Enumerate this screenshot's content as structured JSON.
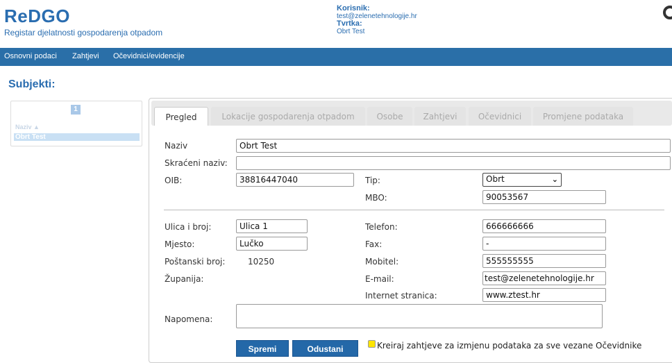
{
  "header": {
    "logo": "ReDGO",
    "tagline": "Registar djelatnosti gospodarenja otpadom",
    "user_label": "Korisnik:",
    "user_value": "test@zelenetehnologije.hr",
    "company_label": "Tvrtka:",
    "company_value": "Obrt Test"
  },
  "nav": {
    "items": [
      "Osnovni podaci",
      "Zahtjevi",
      "Očevidnici/evidencije"
    ]
  },
  "section_title": "Subjekti:",
  "left_list": {
    "page": "1",
    "column_header": "Naziv ▲",
    "selected_row": "Obrt Test"
  },
  "tabs": [
    "Pregled",
    "Lokacije gospodarenja otpadom",
    "Osobe",
    "Zahtjevi",
    "Očevidnici",
    "Promjene podataka"
  ],
  "form": {
    "naziv_label": "Naziv",
    "naziv_value": "Obrt Test",
    "skraceni_label": "Skraćeni naziv:",
    "skraceni_value": "",
    "oib_label": "OIB:",
    "oib_value": "38816447040",
    "tip_label": "Tip:",
    "tip_value": "Obrt",
    "mbo_label": "MBO:",
    "mbo_value": "90053567",
    "ulica_label": "Ulica i broj:",
    "ulica_value": "Ulica 1",
    "telefon_label": "Telefon:",
    "telefon_value": "666666666",
    "mjesto_label": "Mjesto:",
    "mjesto_value": "Lučko",
    "fax_label": "Fax:",
    "fax_value": "-",
    "postanski_label": "Poštanski broj:",
    "postanski_value": "10250",
    "mobitel_label": "Mobitel:",
    "mobitel_value": "555555555",
    "zupanija_label": "Županija:",
    "email_label": "E-mail:",
    "email_value": "test@zelenetehnologije.hr",
    "web_label": "Internet stranica:",
    "web_value": "www.ztest.hr",
    "napomena_label": "Napomena:",
    "napomena_value": ""
  },
  "actions": {
    "save": "Spremi",
    "cancel": "Odustani",
    "checkbox_label": "Kreiraj zahtjeve za izmjenu podataka za sve vezane Očevidnike"
  },
  "colors": {
    "brand": "#2a6db0",
    "navbar": "#2a6fa8",
    "button": "#2468a8",
    "checkbox": "#fde500"
  }
}
